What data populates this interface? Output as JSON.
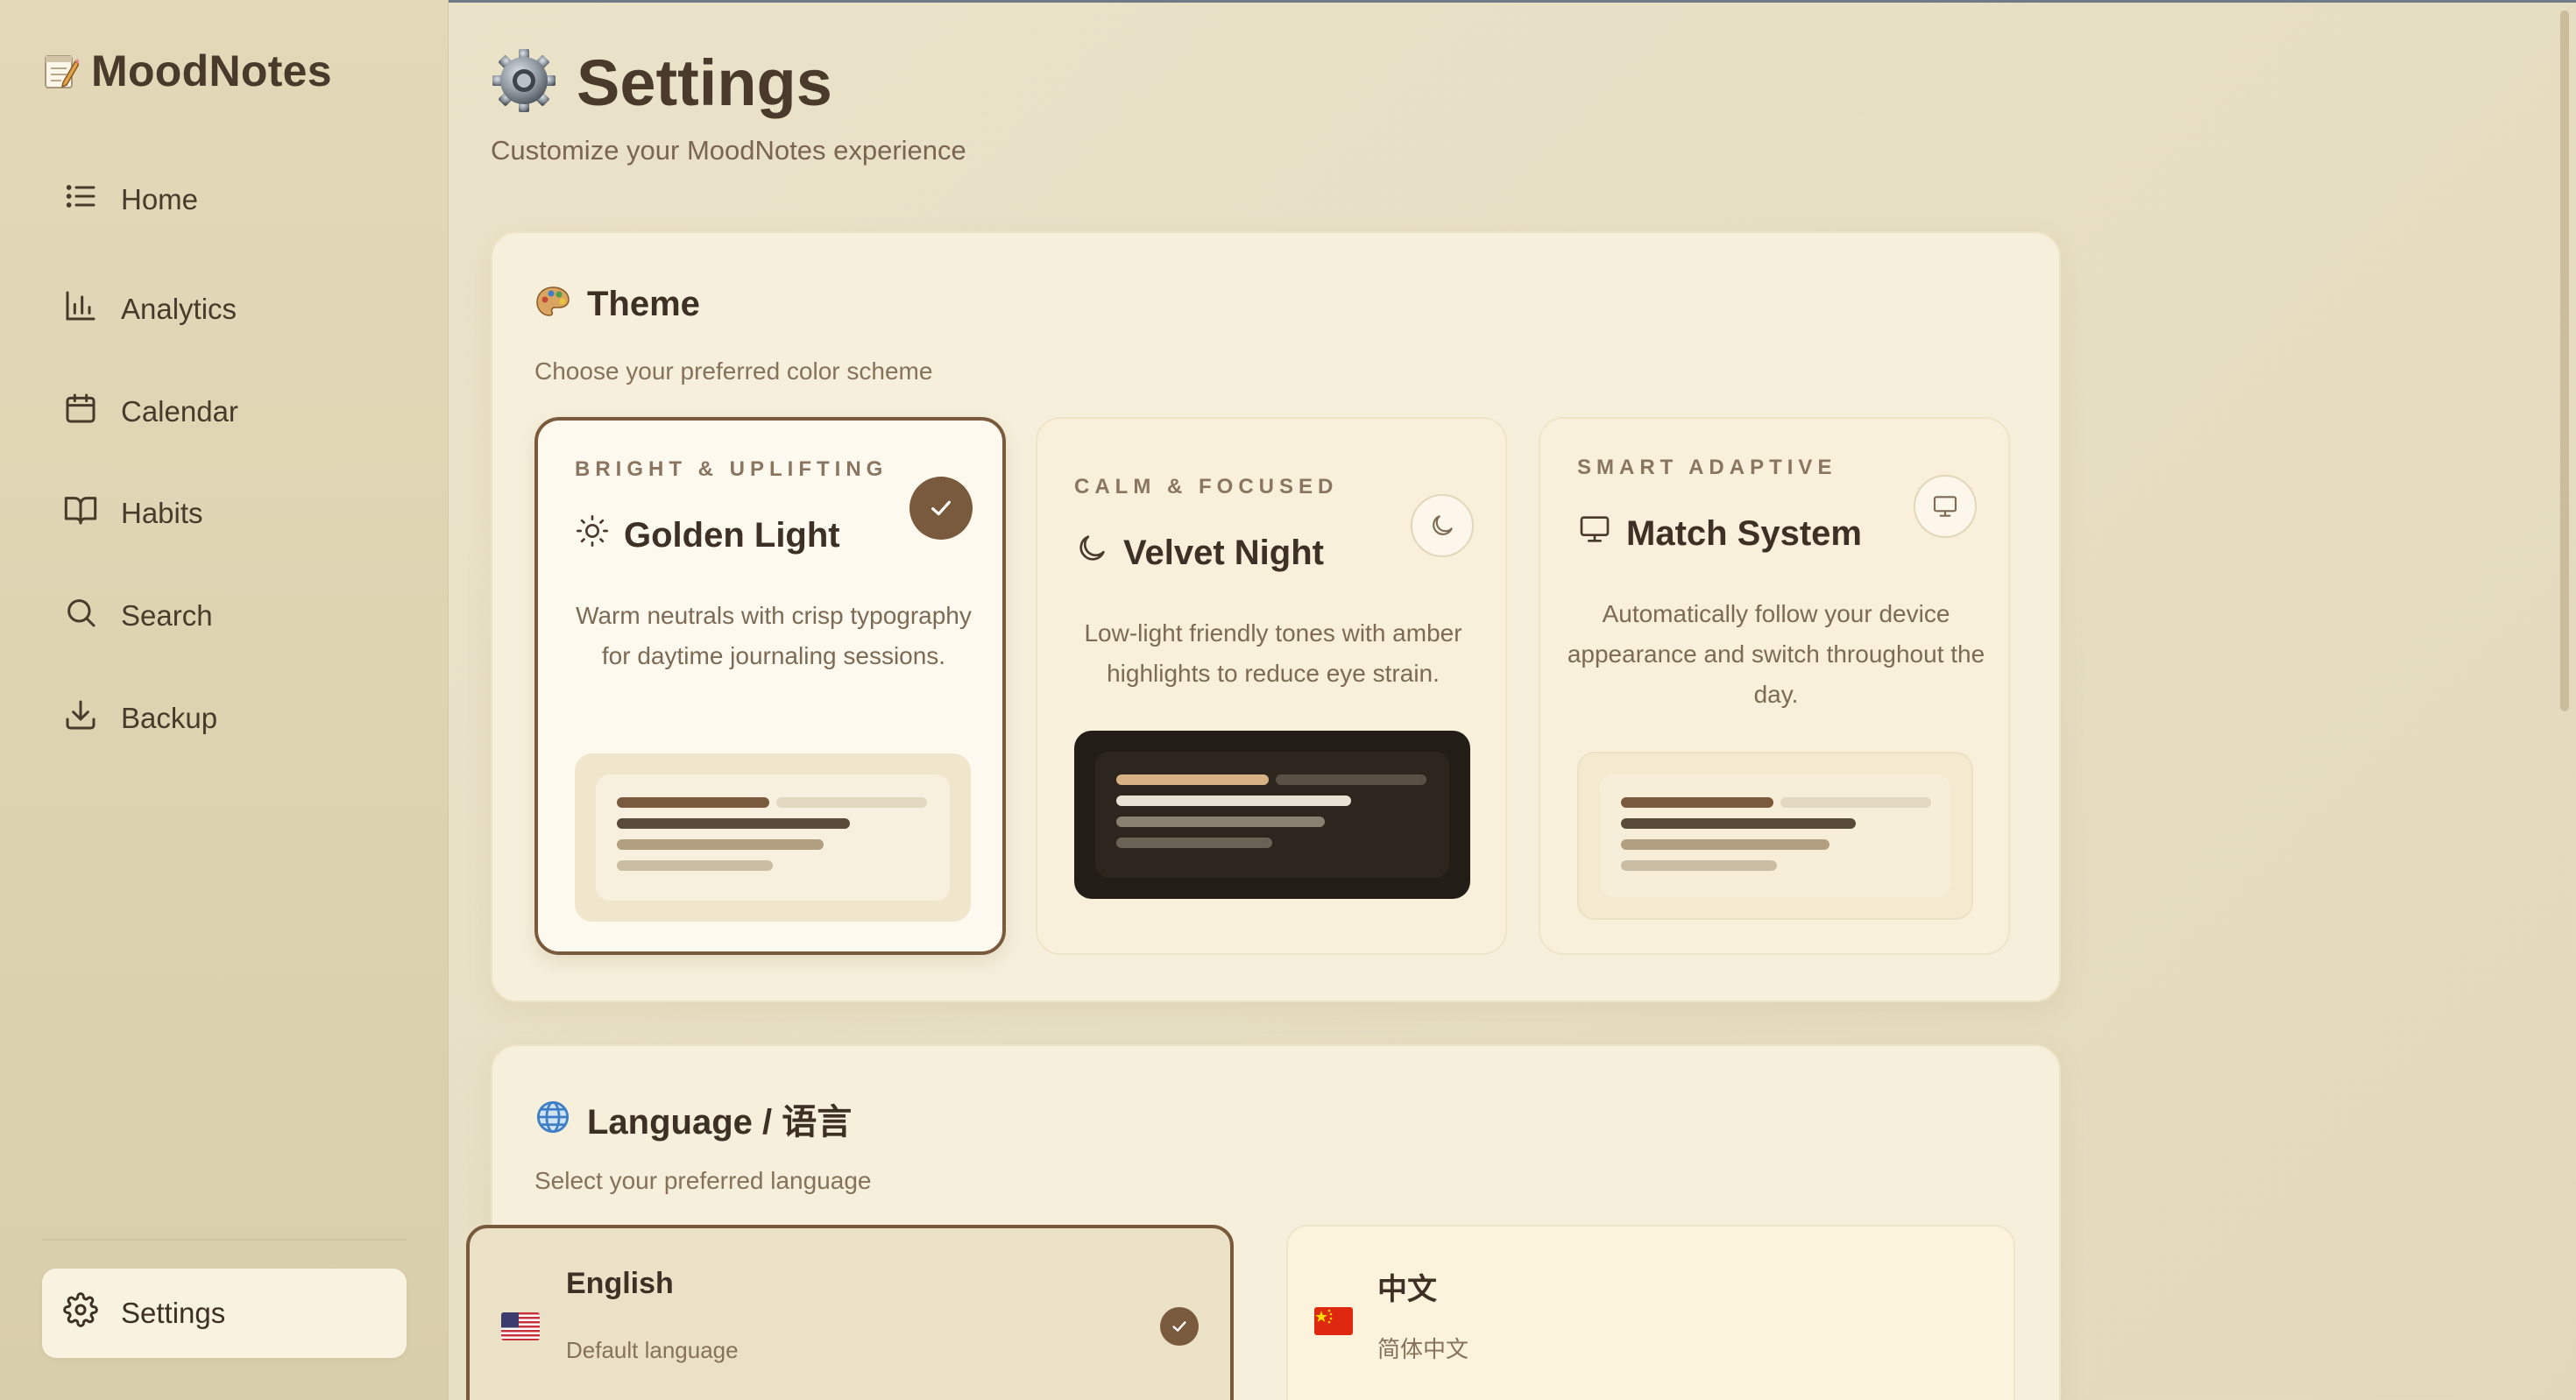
{
  "app": {
    "name": "MoodNotes"
  },
  "sidebar": {
    "items": [
      {
        "label": "Home",
        "icon": "list-icon"
      },
      {
        "label": "Analytics",
        "icon": "bar-chart-icon"
      },
      {
        "label": "Calendar",
        "icon": "calendar-icon"
      },
      {
        "label": "Habits",
        "icon": "book-icon"
      },
      {
        "label": "Search",
        "icon": "search-icon"
      },
      {
        "label": "Backup",
        "icon": "download-icon"
      }
    ],
    "settings": {
      "label": "Settings",
      "icon": "gear-icon",
      "active": true
    }
  },
  "header": {
    "title": "Settings",
    "subtitle": "Customize your MoodNotes experience",
    "icon": "gear-icon"
  },
  "theme": {
    "title": "Theme",
    "icon": "palette-icon",
    "subtitle": "Choose your preferred color scheme",
    "options": [
      {
        "kicker": "BRIGHT & UPLIFTING",
        "title": "Golden Light",
        "icon": "sun-icon",
        "description": "Warm neutrals with crisp typography for daytime journaling sessions.",
        "selected": true
      },
      {
        "kicker": "CALM & FOCUSED",
        "title": "Velvet Night",
        "icon": "moon-icon",
        "description": "Low-light friendly tones with amber highlights to reduce eye strain.",
        "selected": false
      },
      {
        "kicker": "SMART ADAPTIVE",
        "title": "Match System",
        "icon": "monitor-icon",
        "description": "Automatically follow your device appearance and switch throughout the day.",
        "selected": false
      }
    ]
  },
  "language": {
    "title": "Language / 语言",
    "icon": "globe-icon",
    "subtitle": "Select your preferred language",
    "options": [
      {
        "name": "English",
        "sub": "Default language",
        "flag": "us-flag-icon",
        "selected": true
      },
      {
        "name": "中文",
        "sub": "简体中文",
        "flag": "cn-flag-icon",
        "selected": false
      }
    ]
  },
  "colors": {
    "accent": "#7a5a3c",
    "text": "#3d3024",
    "muted": "#86725a",
    "night_bg": "#2a241c"
  }
}
